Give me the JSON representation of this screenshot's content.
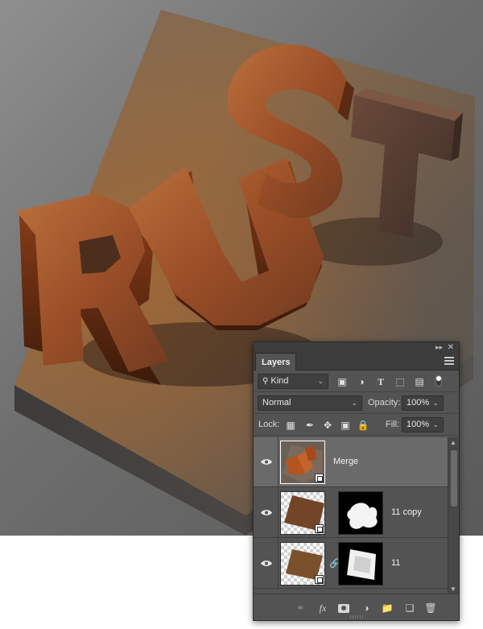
{
  "artwork": {
    "letters": [
      "R",
      "U",
      "S",
      "T"
    ],
    "colors": {
      "background": "#6e6e6e",
      "rust_dark": "#5a2a10",
      "rust": "#b4501c",
      "rust_light": "#e08a3c",
      "plate": "#6b6058"
    }
  },
  "panel": {
    "tab_label": "Layers",
    "collapse_icon": "double-chevron-right-icon",
    "close_icon": "close-icon",
    "filter": {
      "label": "Kind",
      "icons": [
        "image-filter-icon",
        "adjustment-filter-icon",
        "type-filter-icon",
        "shape-filter-icon",
        "smart-object-filter-icon",
        "filter-toggle-icon"
      ]
    },
    "blend_mode": "Normal",
    "opacity": {
      "label": "Opacity:",
      "value": "100%"
    },
    "lock": {
      "label": "Lock:",
      "icons": [
        "lock-transparent-icon",
        "lock-image-icon",
        "lock-position-icon",
        "artboard-icon",
        "lock-all-icon"
      ]
    },
    "fill": {
      "label": "Fill:",
      "value": "100%"
    },
    "layers": [
      {
        "name": "Merge",
        "visible": true,
        "selected": true,
        "has_mask": false
      },
      {
        "name": "11 copy",
        "visible": true,
        "selected": false,
        "has_mask": true
      },
      {
        "name": "11",
        "visible": true,
        "selected": false,
        "has_mask": true,
        "linked": true
      }
    ],
    "footer_icons": [
      "link-layers-icon",
      "fx-icon",
      "add-mask-icon",
      "adjustment-layer-icon",
      "new-group-icon",
      "new-layer-icon",
      "trash-icon"
    ],
    "footer_fx_label": "fx"
  }
}
